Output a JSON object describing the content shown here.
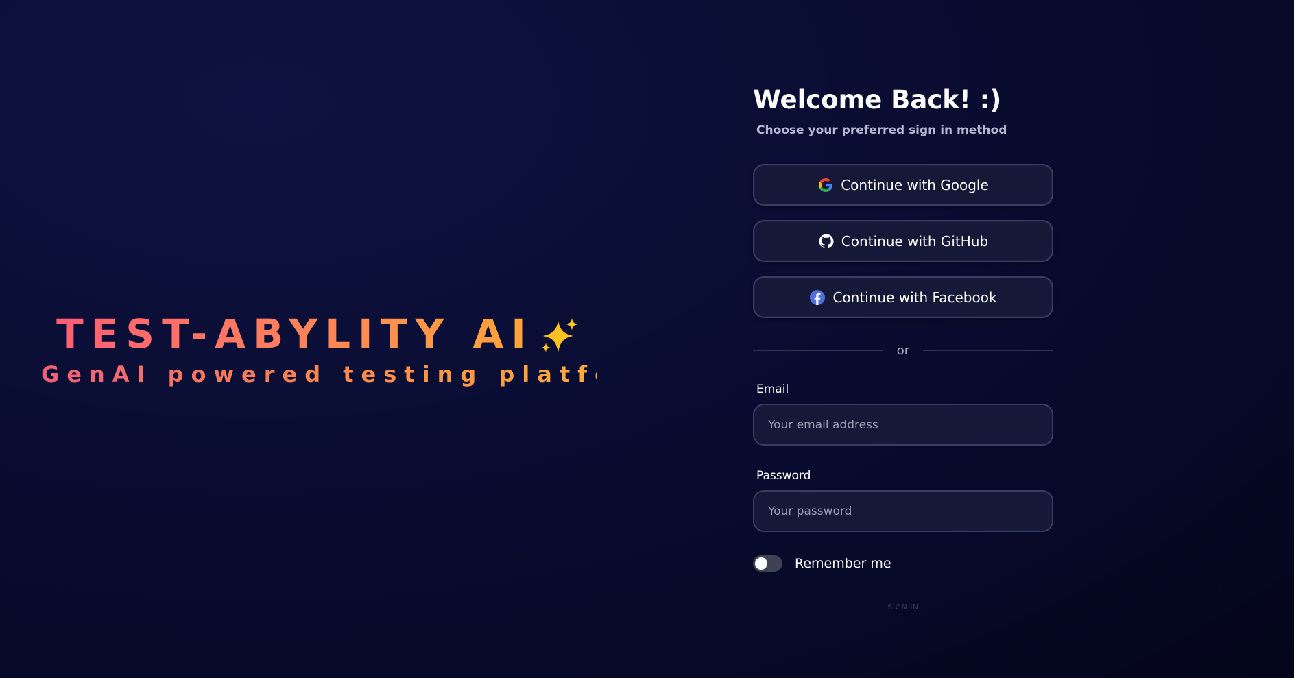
{
  "brand": {
    "title": "TEST-ABYLITY AI",
    "sparkle_icon": "sparkles-icon",
    "tagline": "GenAI powered testing platform"
  },
  "login": {
    "heading": "Welcome Back! :)",
    "subheading": "Choose your preferred sign in method",
    "oauth": [
      {
        "label": "Continue with Google",
        "icon": "google-icon"
      },
      {
        "label": "Continue with GitHub",
        "icon": "github-icon"
      },
      {
        "label": "Continue with Facebook",
        "icon": "facebook-icon"
      }
    ],
    "divider_text": "or",
    "email": {
      "label": "Email",
      "placeholder": "Your email address",
      "value": ""
    },
    "password": {
      "label": "Password",
      "placeholder": "Your password",
      "value": ""
    },
    "remember": {
      "label": "Remember me",
      "checked": false
    },
    "submit_label": "SIGN IN"
  },
  "colors": {
    "background": "#0a0d33",
    "card": "#161838",
    "card_border": "#3a3d62",
    "brand_gradient_start": "#ff5f73",
    "brand_gradient_end": "#ffa63a"
  }
}
